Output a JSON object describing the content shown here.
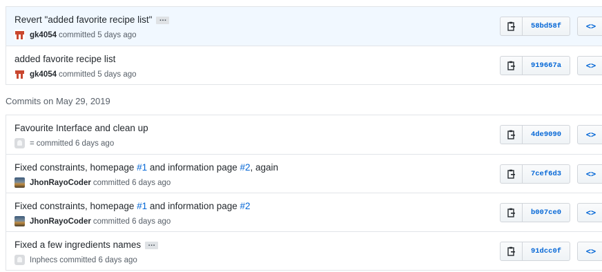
{
  "groups": [
    {
      "commits": [
        {
          "message": "Revert \"added favorite recipe list\"",
          "has_ellipsis": true,
          "author": "gk4054",
          "avatar": "gk",
          "time": "committed 5 days ago",
          "sha": "58bd58f",
          "highlight": true
        },
        {
          "message": "added favorite recipe list",
          "has_ellipsis": false,
          "author": "gk4054",
          "avatar": "gk",
          "time": "committed 5 days ago",
          "sha": "919667a",
          "highlight": false
        }
      ]
    },
    {
      "date_label": "Commits on May 29, 2019",
      "commits": [
        {
          "message": "Favourite Interface and clean up",
          "has_ellipsis": false,
          "author": "=",
          "avatar": "ghost",
          "author_plain": true,
          "time": "committed 6 days ago",
          "sha": "4de9090"
        },
        {
          "message_parts": [
            "Fixed constraints, homepage ",
            "#1",
            " and information page ",
            "#2",
            ", again"
          ],
          "author": "JhonRayoCoder",
          "avatar": "photo",
          "time": "committed 6 days ago",
          "sha": "7cef6d3"
        },
        {
          "message_parts": [
            "Fixed constraints, homepage ",
            "#1",
            " and information page ",
            "#2",
            ""
          ],
          "author": "JhonRayoCoder",
          "avatar": "photo",
          "time": "committed 6 days ago",
          "sha": "b007ce0"
        },
        {
          "message": "Fixed a few ingredients names",
          "has_ellipsis": true,
          "author": "Inphecs",
          "avatar": "ghost",
          "author_plain": true,
          "time": "committed 6 days ago",
          "sha": "91dcc0f"
        }
      ]
    }
  ],
  "ellipsis_label": "…",
  "browse_label": "<>",
  "icons": {
    "copy": "clippy-icon",
    "browse": "code-icon"
  },
  "colors": {
    "link": "#0366d6",
    "highlight_bg": "#f1f8ff"
  }
}
